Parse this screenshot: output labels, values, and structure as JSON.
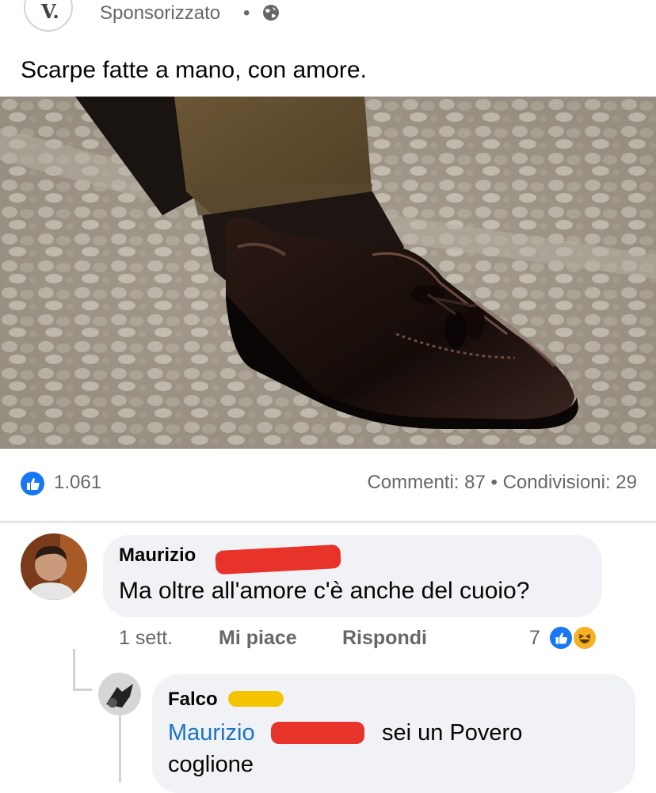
{
  "post": {
    "page_initial": "V.",
    "sponsored_label": "Sponsorizzato",
    "separator": "•",
    "privacy_icon": "globe-icon",
    "caption": "Scarpe fatte a mano, con amore."
  },
  "stats": {
    "likes": "1.061",
    "comments_shares": "Commenti: 87 • Condivisioni: 29"
  },
  "comments": [
    {
      "author": "Maurizio",
      "text": "Ma oltre all'amore c'è anche del cuoio?",
      "time": "1 sett.",
      "like_action": "Mi piace",
      "reply_action": "Rispondi",
      "reaction_count": "7",
      "reactions": [
        "like-icon",
        "haha-icon"
      ]
    },
    {
      "author": "Falco",
      "mention": "Maurizio",
      "text_line1": "sei un Povero",
      "text_line2": "coglione"
    }
  ],
  "colors": {
    "facebook_blue": "#1877f2",
    "mention_blue": "#1b74c4",
    "bubble_bg": "#f0f2f5",
    "secondary_text": "#65676b",
    "redaction": "#e8332b",
    "redaction_yellow": "#f5c400"
  }
}
